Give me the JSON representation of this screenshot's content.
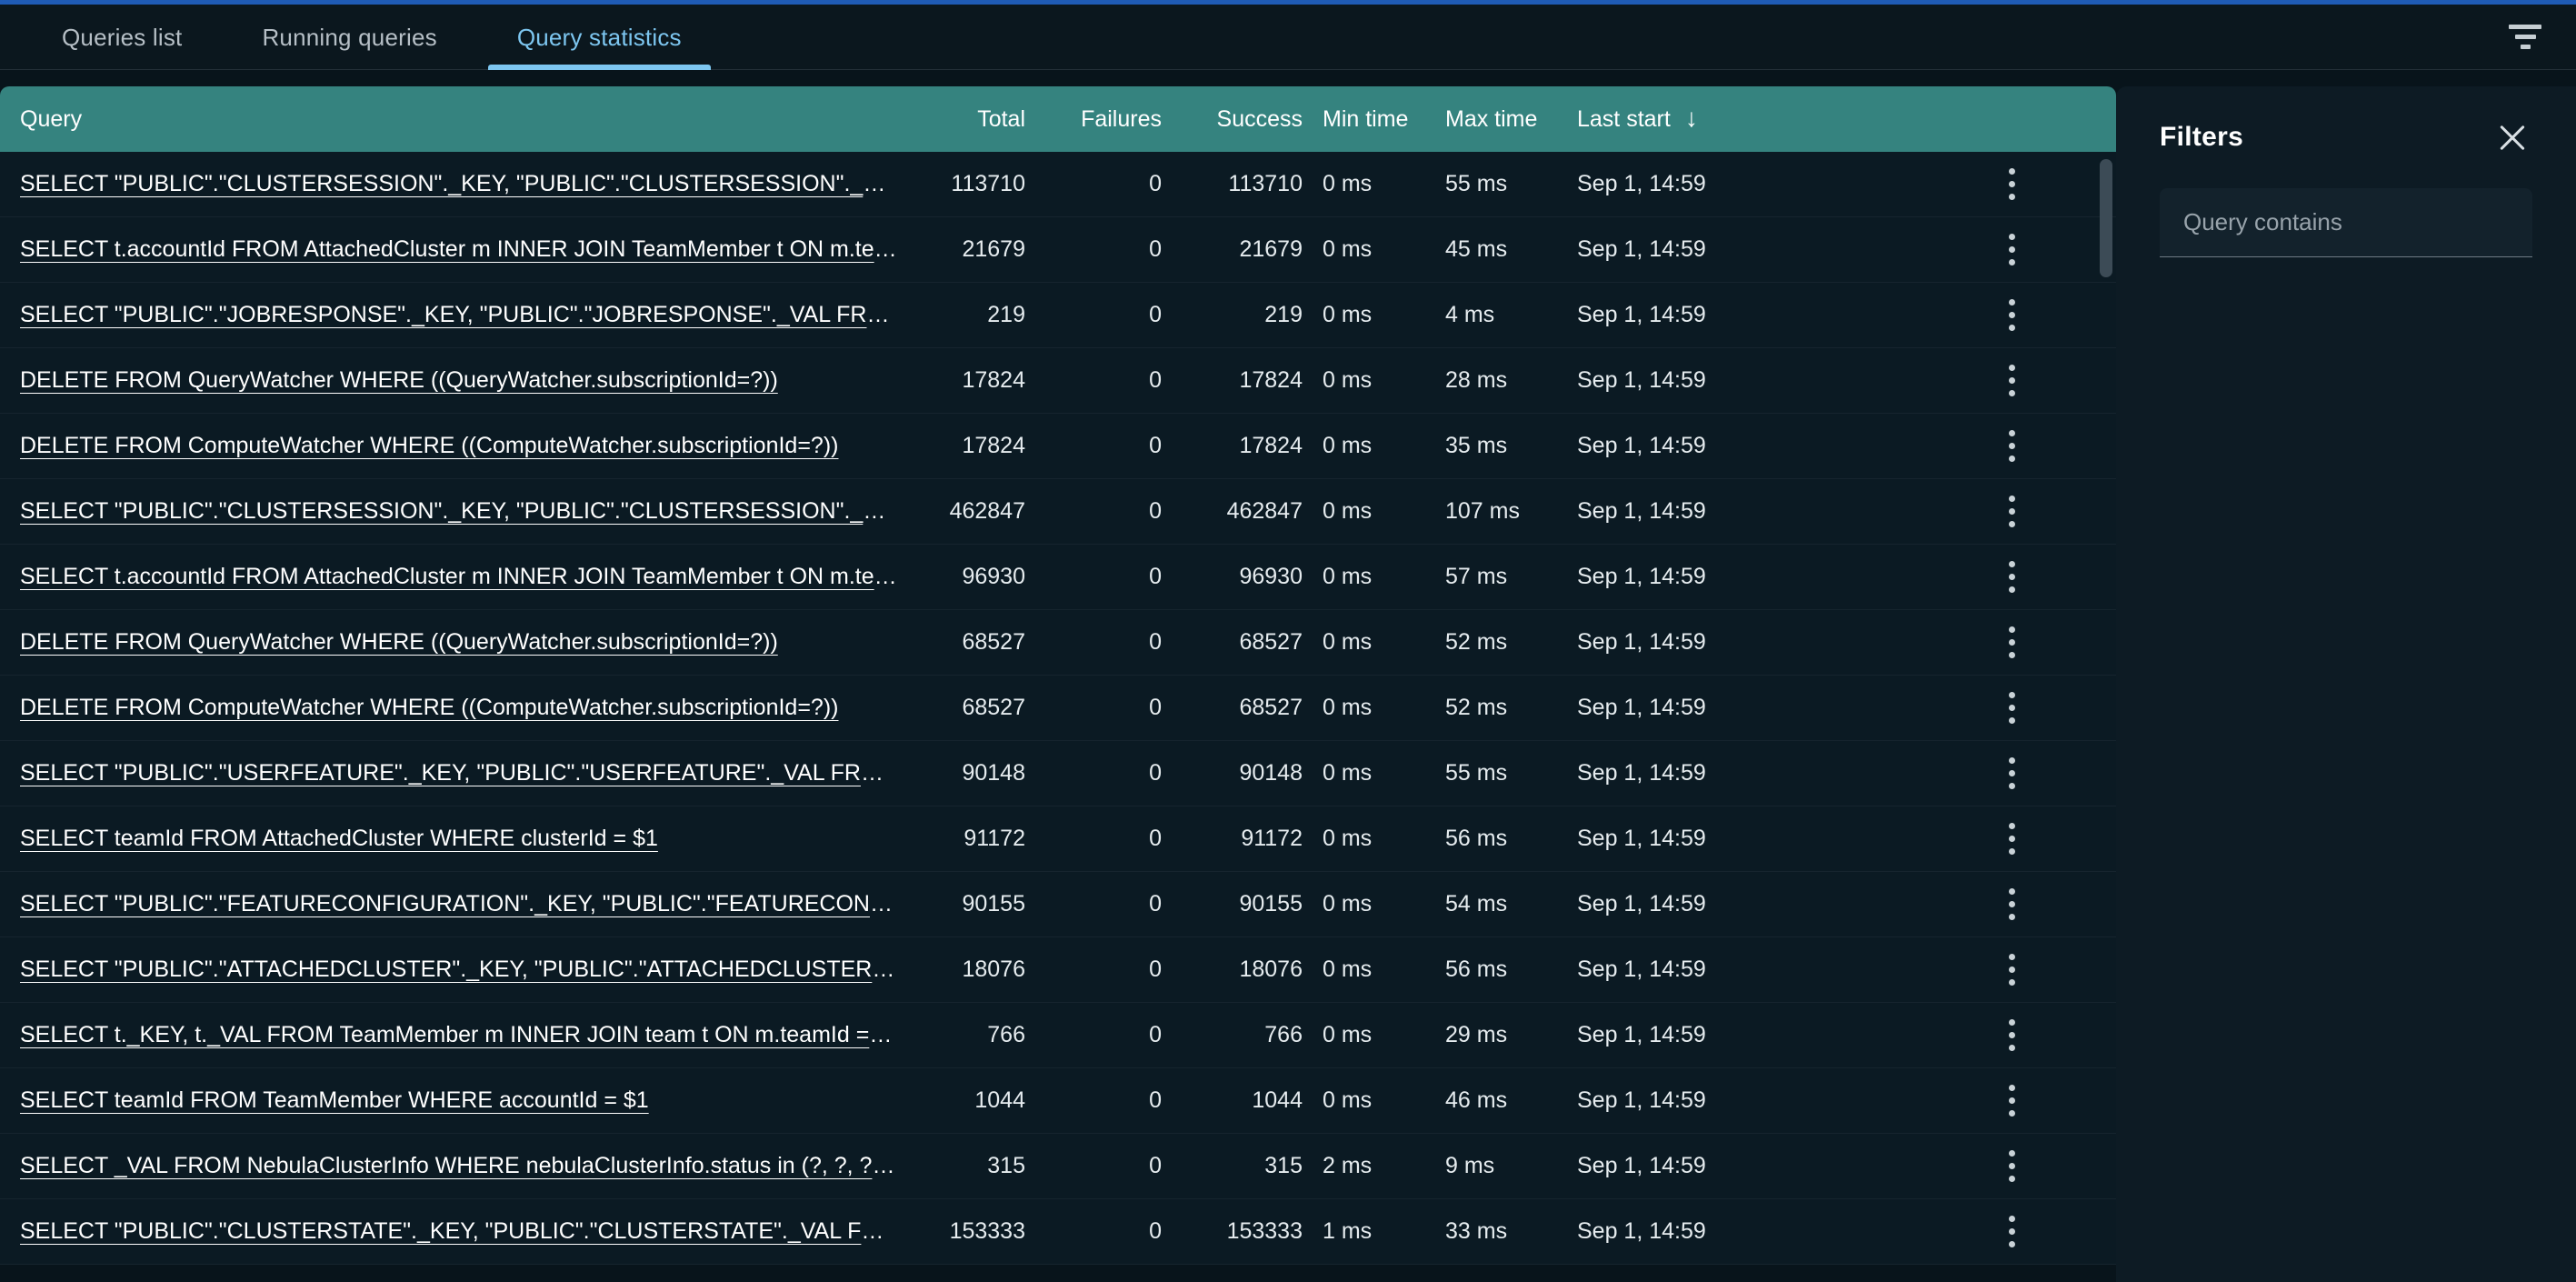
{
  "theme": {
    "accent_blue": "#1f5bb5",
    "tab_active": "#7dc6f0",
    "table_header_bg": "#35837f",
    "row_bg": "#0b1a23",
    "panel_bg": "#0d1b24"
  },
  "tabs": [
    {
      "label": "Queries list",
      "active": false
    },
    {
      "label": "Running queries",
      "active": false
    },
    {
      "label": "Query statistics",
      "active": true
    }
  ],
  "toolbar": {
    "filter_icon": "filter-funnel-icon"
  },
  "table": {
    "columns": [
      {
        "key": "query",
        "label": "Query"
      },
      {
        "key": "total",
        "label": "Total"
      },
      {
        "key": "failures",
        "label": "Failures"
      },
      {
        "key": "success",
        "label": "Success"
      },
      {
        "key": "min_time",
        "label": "Min time"
      },
      {
        "key": "max_time",
        "label": "Max time"
      },
      {
        "key": "last_start",
        "label": "Last start"
      }
    ],
    "sort": {
      "column": "Last start",
      "direction": "desc",
      "arrow_glyph": "↓"
    },
    "row_menu_icon": "kebab-menu-icon",
    "rows": [
      {
        "query": "SELECT \"PUBLIC\".\"CLUSTERSESSION\"._KEY, \"PUBLIC\".\"CLUSTERSESSION\"._VAL FROM …",
        "total": "113710",
        "failures": "0",
        "success": "113710",
        "min_time": "0 ms",
        "max_time": "55 ms",
        "last_start": "Sep 1, 14:59"
      },
      {
        "query": "SELECT t.accountId FROM AttachedCluster m INNER JOIN TeamMember t ON m.team…",
        "total": "21679",
        "failures": "0",
        "success": "21679",
        "min_time": "0 ms",
        "max_time": "45 ms",
        "last_start": "Sep 1, 14:59"
      },
      {
        "query": "SELECT \"PUBLIC\".\"JOBRESPONSE\"._KEY, \"PUBLIC\".\"JOBRESPONSE\"._VAL FROM JobR…",
        "total": "219",
        "failures": "0",
        "success": "219",
        "min_time": "0 ms",
        "max_time": "4 ms",
        "last_start": "Sep 1, 14:59"
      },
      {
        "query": "DELETE FROM QueryWatcher WHERE ((QueryWatcher.subscriptionId=?))",
        "total": "17824",
        "failures": "0",
        "success": "17824",
        "min_time": "0 ms",
        "max_time": "28 ms",
        "last_start": "Sep 1, 14:59"
      },
      {
        "query": "DELETE FROM ComputeWatcher WHERE ((ComputeWatcher.subscriptionId=?))",
        "total": "17824",
        "failures": "0",
        "success": "17824",
        "min_time": "0 ms",
        "max_time": "35 ms",
        "last_start": "Sep 1, 14:59"
      },
      {
        "query": "SELECT \"PUBLIC\".\"CLUSTERSESSION\"._KEY, \"PUBLIC\".\"CLUSTERSESSION\"._VAL FROM …",
        "total": "462847",
        "failures": "0",
        "success": "462847",
        "min_time": "0 ms",
        "max_time": "107 ms",
        "last_start": "Sep 1, 14:59"
      },
      {
        "query": "SELECT t.accountId FROM AttachedCluster m INNER JOIN TeamMember t ON m.team…",
        "total": "96930",
        "failures": "0",
        "success": "96930",
        "min_time": "0 ms",
        "max_time": "57 ms",
        "last_start": "Sep 1, 14:59"
      },
      {
        "query": "DELETE FROM QueryWatcher WHERE ((QueryWatcher.subscriptionId=?))",
        "total": "68527",
        "failures": "0",
        "success": "68527",
        "min_time": "0 ms",
        "max_time": "52 ms",
        "last_start": "Sep 1, 14:59"
      },
      {
        "query": "DELETE FROM ComputeWatcher WHERE ((ComputeWatcher.subscriptionId=?))",
        "total": "68527",
        "failures": "0",
        "success": "68527",
        "min_time": "0 ms",
        "max_time": "52 ms",
        "last_start": "Sep 1, 14:59"
      },
      {
        "query": "SELECT \"PUBLIC\".\"USERFEATURE\"._KEY, \"PUBLIC\".\"USERFEATURE\"._VAL FROM UserFe…",
        "total": "90148",
        "failures": "0",
        "success": "90148",
        "min_time": "0 ms",
        "max_time": "55 ms",
        "last_start": "Sep 1, 14:59"
      },
      {
        "query": "SELECT teamId FROM AttachedCluster WHERE clusterId = $1",
        "total": "91172",
        "failures": "0",
        "success": "91172",
        "min_time": "0 ms",
        "max_time": "56 ms",
        "last_start": "Sep 1, 14:59"
      },
      {
        "query": "SELECT \"PUBLIC\".\"FEATURECONFIGURATION\"._KEY, \"PUBLIC\".\"FEATURECONFIGURATI…",
        "total": "90155",
        "failures": "0",
        "success": "90155",
        "min_time": "0 ms",
        "max_time": "54 ms",
        "last_start": "Sep 1, 14:59"
      },
      {
        "query": "SELECT \"PUBLIC\".\"ATTACHEDCLUSTER\"._KEY, \"PUBLIC\".\"ATTACHEDCLUSTER\"._VAL FR…",
        "total": "18076",
        "failures": "0",
        "success": "18076",
        "min_time": "0 ms",
        "max_time": "56 ms",
        "last_start": "Sep 1, 14:59"
      },
      {
        "query": "SELECT t._KEY, t._VAL FROM TeamMember m INNER JOIN team t ON m.teamId = t.id …",
        "total": "766",
        "failures": "0",
        "success": "766",
        "min_time": "0 ms",
        "max_time": "29 ms",
        "last_start": "Sep 1, 14:59"
      },
      {
        "query": "SELECT teamId FROM TeamMember WHERE accountId = $1",
        "total": "1044",
        "failures": "0",
        "success": "1044",
        "min_time": "0 ms",
        "max_time": "46 ms",
        "last_start": "Sep 1, 14:59"
      },
      {
        "query": "SELECT _VAL FROM NebulaClusterInfo WHERE nebulaClusterInfo.status in (?, ?, ?, ?, ?)",
        "total": "315",
        "failures": "0",
        "success": "315",
        "min_time": "2 ms",
        "max_time": "9 ms",
        "last_start": "Sep 1, 14:59"
      },
      {
        "query": "SELECT \"PUBLIC\".\"CLUSTERSTATE\"._KEY, \"PUBLIC\".\"CLUSTERSTATE\"._VAL FROM Clus…",
        "total": "153333",
        "failures": "0",
        "success": "153333",
        "min_time": "1 ms",
        "max_time": "33 ms",
        "last_start": "Sep 1, 14:59"
      }
    ]
  },
  "filters_panel": {
    "title": "Filters",
    "close_icon": "close-icon",
    "query_contains": {
      "value": "",
      "placeholder": "Query contains"
    }
  }
}
